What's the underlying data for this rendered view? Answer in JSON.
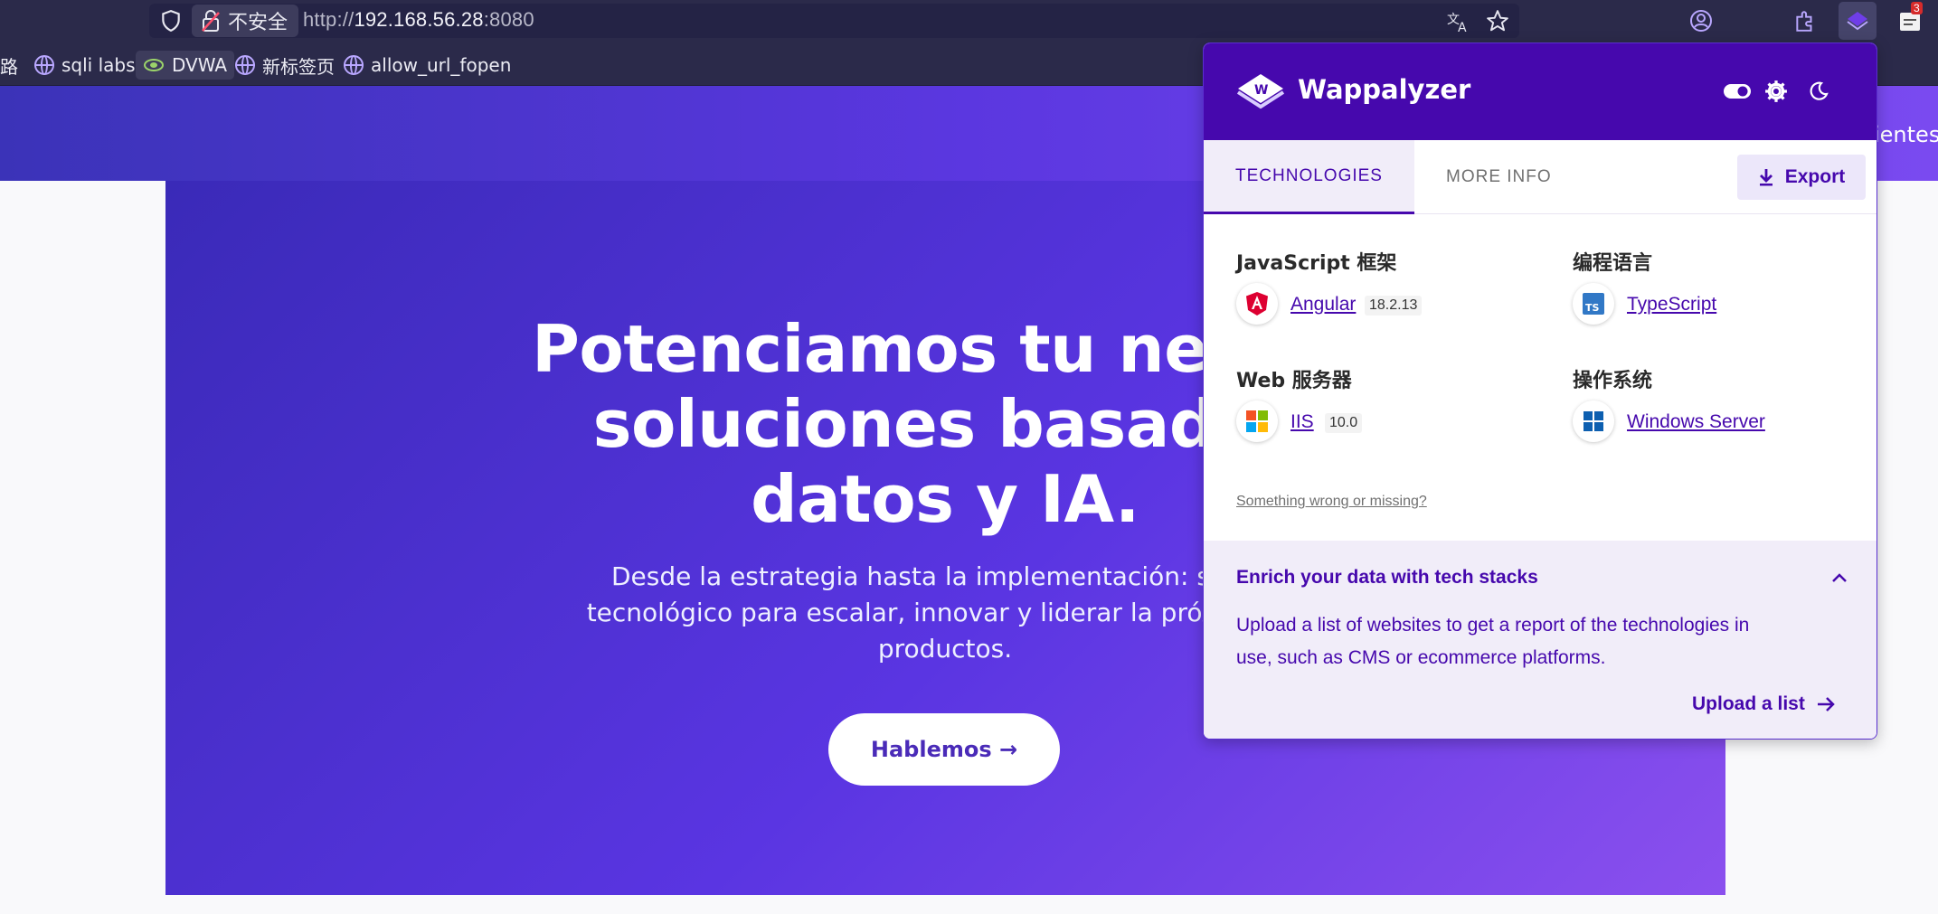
{
  "browser": {
    "security_label": "不安全",
    "url_scheme": "http://",
    "url_host": "192.168.56.28",
    "url_port": ":8080",
    "notification_count": "3",
    "bookmarks": [
      {
        "label": "路"
      },
      {
        "label": "sqli labs"
      },
      {
        "label": "DVWA"
      },
      {
        "label": "新标签页"
      },
      {
        "label": "allow_url_fopen"
      }
    ]
  },
  "page": {
    "nav_partial": "ientes",
    "hero_title": "Potenciamos tu negoci\nsoluciones basadas \ndatos y IA.",
    "hero_subtitle": "Desde la estrategia hasta la implementación: somos\ntecnológico para escalar, innovar y liderar la próxima ge\nproductos.",
    "cta_label": "Hablemos →"
  },
  "popup": {
    "brand": "Wappalyzer",
    "tabs": [
      {
        "label": "TECHNOLOGIES",
        "active": true
      },
      {
        "label": "MORE INFO",
        "active": false
      }
    ],
    "export_label": "Export",
    "categories": [
      {
        "title": "JavaScript 框架",
        "tech": "Angular",
        "version": "18.2.13"
      },
      {
        "title": "编程语言",
        "tech": "TypeScript",
        "version": ""
      },
      {
        "title": "Web 服务器",
        "tech": "IIS",
        "version": "10.0"
      },
      {
        "title": "操作系统",
        "tech": "Windows Server",
        "version": ""
      }
    ],
    "wrong_link": "Something wrong or missing?",
    "enrich": {
      "title": "Enrich your data with tech stacks",
      "body": "Upload a list of websites to get a report of the technologies in use, such as CMS or ecommerce platforms.",
      "action": "Upload a list"
    }
  },
  "colors": {
    "brand_purple": "#4608ad",
    "hero_gradient_start": "#3a2ab8",
    "hero_gradient_end": "#8b50ee"
  }
}
